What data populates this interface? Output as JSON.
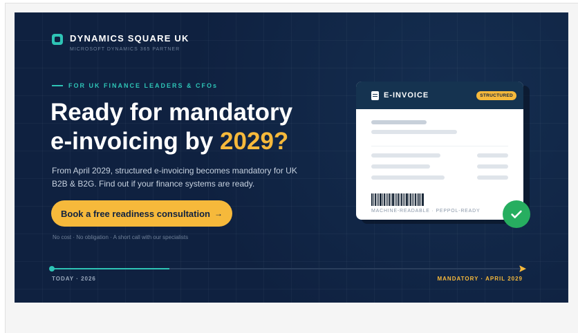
{
  "brand": {
    "name": "DYNAMICS SQUARE UK",
    "tagline": "MICROSOFT DYNAMICS 365 PARTNER"
  },
  "hero": {
    "eyebrow": "FOR UK FINANCE LEADERS & CFOs",
    "headline_line1": "Ready for mandatory",
    "headline_line2_start": "e-invoicing by ",
    "headline_accent": "2029?",
    "description": "From April 2029, structured e-invoicing becomes mandatory for UK B2B & B2G. Find out if your finance systems are ready.",
    "cta_label": "Book a free readiness consultation",
    "cta_arrow": "→",
    "fine_print": "No cost · No obligation · A short call with our specialists"
  },
  "timeline": {
    "start_label": "TODAY · 2026",
    "end_label": "MANDATORY · APRIL 2029",
    "progress_fraction": 0.25
  },
  "invoice_card": {
    "title": "E-INVOICE",
    "badge": "STRUCTURED",
    "caption": "MACHINE-READABLE · PEPPOL-READY"
  },
  "colors": {
    "background": "#0f2140",
    "teal_accent": "#2ec4b6",
    "gold_accent": "#f6b93b",
    "success": "#27ae60"
  },
  "icons": {
    "brand_logo": "rounded-square-icon",
    "card_title": "document-icon",
    "status": "checkmark-icon"
  }
}
